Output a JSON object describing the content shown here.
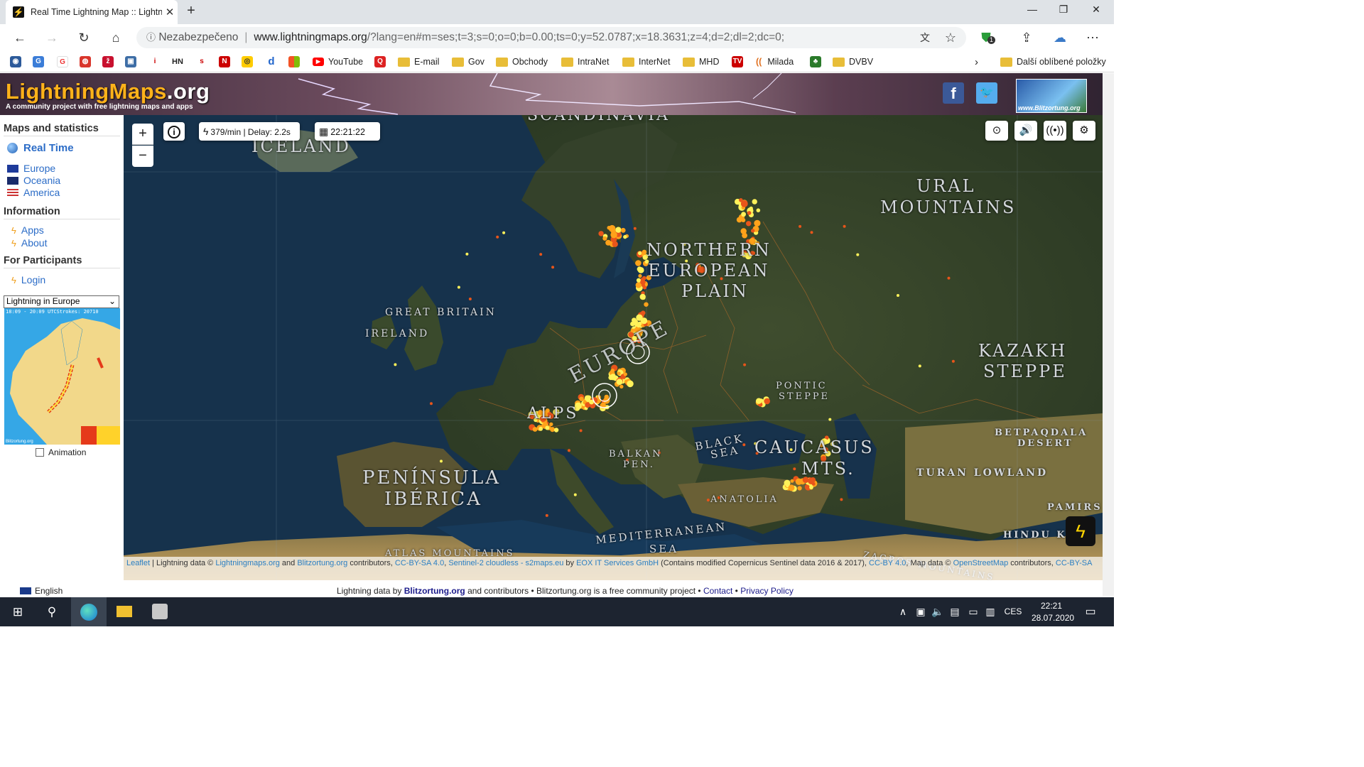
{
  "browser": {
    "tab_title": "Real Time Lightning Map :: Lightn",
    "url_warning": "Nezabezpečeno",
    "url_host": "www.lightningmaps.org",
    "url_path": "/?lang=en#m=ses;t=3;s=0;o=0;b=0.00;ts=0;y=52.0787;x=18.3631;z=4;d=2;dl=2;dc=0;",
    "extension_badge": "1"
  },
  "favorites": {
    "items": [
      {
        "label": "YouTube"
      },
      {
        "label": "E-mail"
      },
      {
        "label": "Gov"
      },
      {
        "label": "Obchody"
      },
      {
        "label": "IntraNet"
      },
      {
        "label": "InterNet"
      },
      {
        "label": "MHD"
      },
      {
        "label": "Milada"
      },
      {
        "label": "DVBV"
      }
    ],
    "hn_label": "HN",
    "other_label": "Další oblíbené položky"
  },
  "site": {
    "logo_main": "LightningMaps",
    "logo_tld": ".org",
    "tagline": "A community project with free lightning maps and apps",
    "blitz_logo_text": "www.Blitzortung.org"
  },
  "sidebar": {
    "maps_heading": "Maps and statistics",
    "realtime_label": "Real Time",
    "regions": [
      {
        "label": "Europe"
      },
      {
        "label": "Oceania"
      },
      {
        "label": "America"
      }
    ],
    "info_heading": "Information",
    "info_links": [
      {
        "label": "Apps"
      },
      {
        "label": "About"
      }
    ],
    "participants_heading": "For Participants",
    "login_label": "Login",
    "select_value": "Lightning in Europe",
    "minimap_header": "18:09 - 20:09 UTCStrokes: 20710",
    "minimap_footer": "Blitzortung.org",
    "animation_label": "Animation"
  },
  "map": {
    "rate_text": "379/min | Delay: 2.2s",
    "time_text": "22:21:22",
    "labels": {
      "scandinavia": "SCANDINAVIA",
      "iceland": "ICELAND",
      "ural1": "URAL",
      "ural2": "MOUNTAINS",
      "nep1": "NORTHERN",
      "nep2": "EUROPEAN",
      "nep3": "PLAIN",
      "gb": "GREAT BRITAIN",
      "ireland": "IRELAND",
      "europe": "EUROPE",
      "kaz1": "KAZAKH",
      "kaz2": "STEPPE",
      "pontic1": "PONTIC",
      "pontic2": "STEPPE",
      "alps": "ALPS",
      "betpaq1": "BETPAQDALA",
      "betpaq2": "DESERT",
      "black1": "BLACK",
      "black2": "SEA",
      "caucasus1": "CAUCASUS",
      "caucasus2": "MTS.",
      "balkan1": "BALKAN",
      "balkan2": "PEN.",
      "iberia1": "PENÍNSULA",
      "iberia2": "IBÉRICA",
      "turan": "TURAN LOWLAND",
      "anatolia": "ANATOLIA",
      "pamirs": "PAMIRS",
      "med1": "MEDITERRANEAN",
      "med2": "SEA",
      "hindu": "HINDU K",
      "atlas": "ATLAS MOUNTAINS",
      "zagros": "ZAGROS MOUNTAINS"
    },
    "attribution": {
      "leaflet": "Leaflet",
      "t1": " | Lightning data © ",
      "lm": "Lightningmaps.org",
      "t2": " and ",
      "bz": "Blitzortung.org",
      "t3": " contributors, ",
      "cc1": "CC-BY-SA 4.0",
      "t4": ", ",
      "s2": "Sentinel-2 cloudless - s2maps.eu",
      "t5": " by ",
      "eox": "EOX IT Services GmbH",
      "t6": " (Contains modified Copernicus Sentinel data 2016 & 2017), ",
      "cc2": "CC-BY 4.0",
      "t7": ", Map data © ",
      "osm": "OpenStreetMap",
      "t8": " contributors, ",
      "cc3": "CC-BY-SA"
    }
  },
  "footer": {
    "language": "English",
    "pre": "Lightning data by ",
    "bz": "Blitzortung.org",
    "mid": " and contributors • Blitzortung.org is a free community project • ",
    "contact": "Contact",
    "dot": " • ",
    "privacy": "Privacy Policy"
  },
  "taskbar": {
    "lang": "CES",
    "time": "22:21",
    "date": "28.07.2020"
  },
  "colors": {
    "strike_new": "#fff25a",
    "strike_mid": "#ffa21a",
    "strike_old": "#e8551a",
    "logo": "#ffb21a",
    "link": "#2b6cc7"
  }
}
